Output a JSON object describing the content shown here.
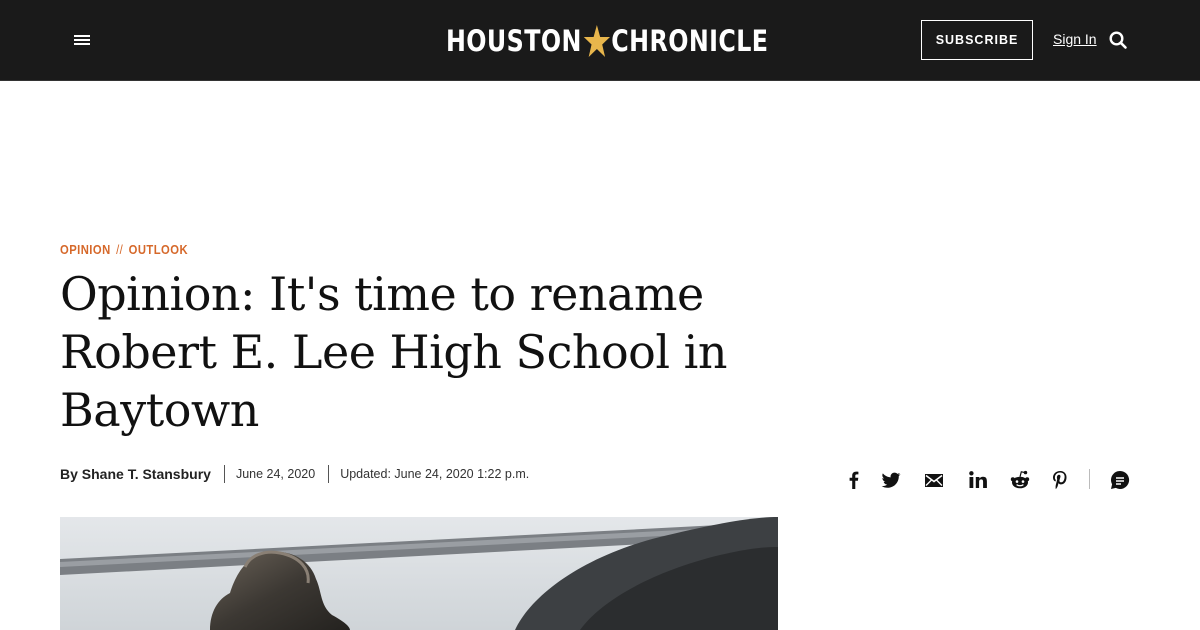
{
  "header": {
    "logo_left": "HOUSTON",
    "logo_right": "CHRONICLE",
    "subscribe_label": "SUBSCRIBE",
    "signin_label": "Sign In",
    "background_color": "#1a1a1a",
    "icons": [
      "menu-icon",
      "star-icon",
      "search-icon"
    ]
  },
  "article": {
    "kicker": [
      "OPINION",
      "OUTLOOK"
    ],
    "kicker_separator": "//",
    "kicker_color": "#d6682a",
    "headline": "Opinion: It's time to rename Robert E. Lee High School in Baytown",
    "byline": "By Shane T. Stansbury",
    "date": "June 24, 2020",
    "updated": "Updated: June 24, 2020 1:22 p.m."
  },
  "share": {
    "icons": [
      "facebook-icon",
      "twitter-icon",
      "email-icon",
      "linkedin-icon",
      "reddit-icon",
      "pinterest-icon",
      "comments-icon"
    ]
  }
}
